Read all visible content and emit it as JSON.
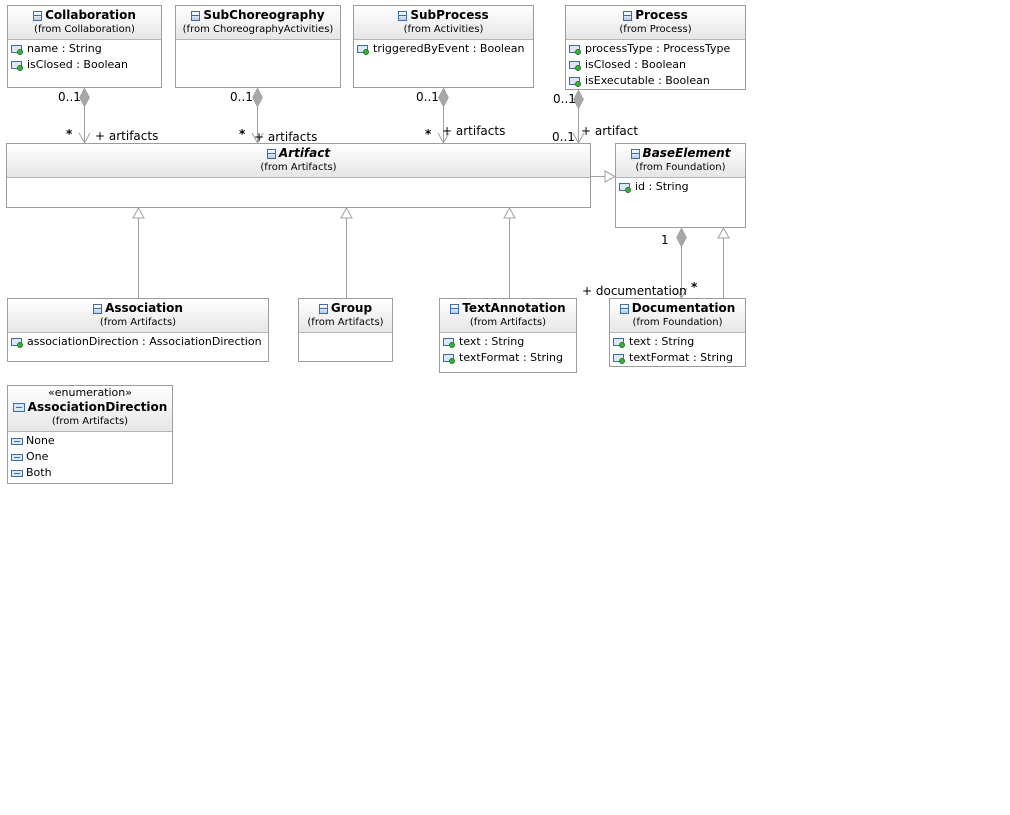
{
  "classes": {
    "collaboration": {
      "name": "Collaboration",
      "from": "(from Collaboration)",
      "attrs": [
        "name : String",
        "isClosed : Boolean"
      ]
    },
    "subchoreography": {
      "name": "SubChoreography",
      "from": "(from ChoreographyActivities)"
    },
    "subprocess": {
      "name": "SubProcess",
      "from": "(from Activities)",
      "attrs": [
        "triggeredByEvent : Boolean"
      ]
    },
    "process": {
      "name": "Process",
      "from": "(from Process)",
      "attrs": [
        "processType : ProcessType",
        "isClosed : Boolean",
        "isExecutable : Boolean"
      ]
    },
    "artifact": {
      "name": "Artifact",
      "from": "(from Artifacts)"
    },
    "baseelement": {
      "name": "BaseElement",
      "from": "(from Foundation)",
      "attrs": [
        "id : String"
      ]
    },
    "association": {
      "name": "Association",
      "from": "(from Artifacts)",
      "attrs": [
        "associationDirection : AssociationDirection"
      ]
    },
    "group": {
      "name": "Group",
      "from": "(from Artifacts)"
    },
    "textannotation": {
      "name": "TextAnnotation",
      "from": "(from Artifacts)",
      "attrs": [
        "text : String",
        "textFormat : String"
      ]
    },
    "documentation": {
      "name": "Documentation",
      "from": "(from Foundation)",
      "attrs": [
        "text : String",
        "textFormat : String"
      ]
    },
    "associationdirection": {
      "stereotype": "«enumeration»",
      "name": "AssociationDirection",
      "from": "(from Artifacts)",
      "literals": [
        "None",
        "One",
        "Both"
      ]
    }
  },
  "labels": {
    "collab_mult_top": "0..1",
    "collab_mult_bottom": "*",
    "collab_role": "+ artifacts",
    "subchor_mult_top": "0..1",
    "subchor_mult_bottom": "*",
    "subchor_role": "+ artifacts",
    "subproc_mult_top": "0..1",
    "subproc_mult_bottom": "*",
    "subproc_role": "+ artifacts",
    "process_mult_top": "0..1",
    "process_mult_bottom": "0..1",
    "process_role": "+ artifact",
    "doc_mult_top": "1",
    "doc_mult_bottom": "*",
    "doc_role": "+ documentation"
  },
  "colors": {
    "border": "#9c9c9c",
    "line": "#a0a0a0",
    "diamond": "#a8a8a8",
    "icon": "#3a6ea5"
  }
}
